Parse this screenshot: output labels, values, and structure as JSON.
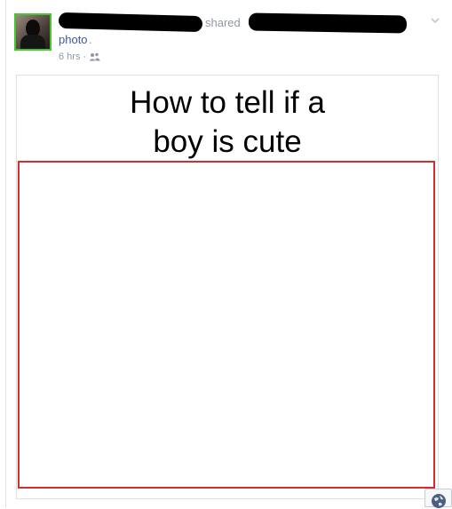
{
  "post": {
    "shared_text": "shared",
    "photo_link": "photo",
    "photo_suffix": ".",
    "timestamp": "6 hrs",
    "separator": "·",
    "audience_icon": "friends-icon",
    "menu_icon": "chevron-down-icon"
  },
  "image": {
    "caption_line_1": "How to tell if a",
    "caption_line_2": "boy is cute",
    "frame_color": "#d32f2f"
  },
  "corner": {
    "icon": "globe-icon"
  },
  "colors": {
    "meta_gray": "#9197a3",
    "link_blue": "#3b5998",
    "avatar_border": "#43c72b"
  }
}
